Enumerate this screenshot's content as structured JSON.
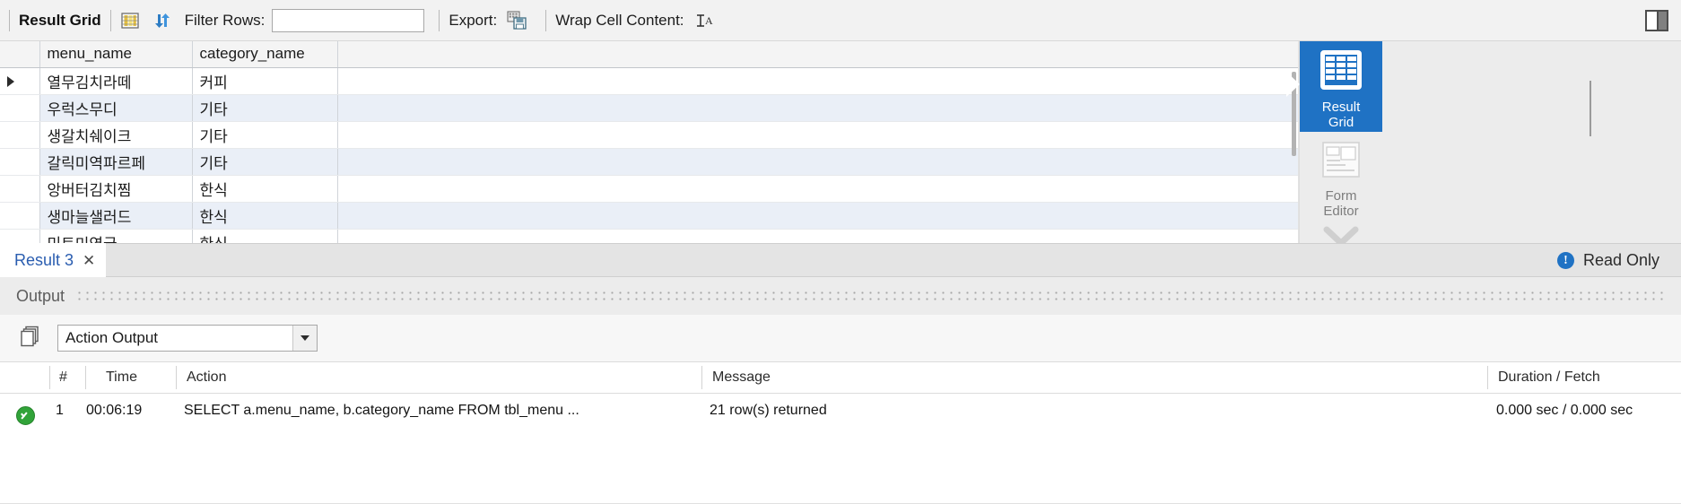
{
  "toolbar": {
    "result_grid_label": "Result Grid",
    "grid_icon": "grid-columns-icon",
    "refresh_icon": "refresh-arrows-icon",
    "filter_label": "Filter Rows:",
    "filter_value": "",
    "filter_placeholder": "",
    "export_label": "Export:",
    "export_icon": "export-save-icon",
    "wrap_label": "Wrap Cell Content:",
    "wrap_icon": "wrap-text-icon",
    "panel_toggle_icon": "toggle-side-panel-icon"
  },
  "grid": {
    "columns": [
      "menu_name",
      "category_name"
    ],
    "selected_row_index": 0,
    "rows": [
      {
        "menu_name": "열무김치라떼",
        "category_name": "커피"
      },
      {
        "menu_name": "우럭스무디",
        "category_name": "기타"
      },
      {
        "menu_name": "생갈치쉐이크",
        "category_name": "기타"
      },
      {
        "menu_name": "갈릭미역파르페",
        "category_name": "기타"
      },
      {
        "menu_name": "앙버터김치찜",
        "category_name": "한식"
      },
      {
        "menu_name": "생마늘샐러드",
        "category_name": "한식"
      },
      {
        "menu_name": "민트미역국",
        "category_name": "한식"
      }
    ]
  },
  "view_rail": {
    "items": [
      {
        "label": "Result\nGrid",
        "line1": "Result",
        "line2": "Grid",
        "icon": "table-grid-icon",
        "active": true
      },
      {
        "label": "Form\nEditor",
        "line1": "Form",
        "line2": "Editor",
        "icon": "form-editor-icon",
        "active": false
      }
    ],
    "expand_icon": "chevron-down-icon",
    "accent_color": "#1f72c4"
  },
  "result_tab": {
    "label": "Result 3",
    "close_icon": "close-icon",
    "status_icon": "info-icon",
    "status_text": "Read Only"
  },
  "output_panel": {
    "title": "Output",
    "copy_icon": "copy-rows-icon",
    "selected_view": "Action Output",
    "dropdown_icon": "chevron-down-icon",
    "columns": [
      "#",
      "Time",
      "Action",
      "Message",
      "Duration / Fetch"
    ],
    "rows": [
      {
        "status": "success",
        "num": "1",
        "time": "00:06:19",
        "action": "SELECT    a.menu_name,   b.category_name FROM    tbl_menu ...",
        "message": "21 row(s) returned",
        "duration": "0.000 sec / 0.000 sec"
      }
    ]
  }
}
